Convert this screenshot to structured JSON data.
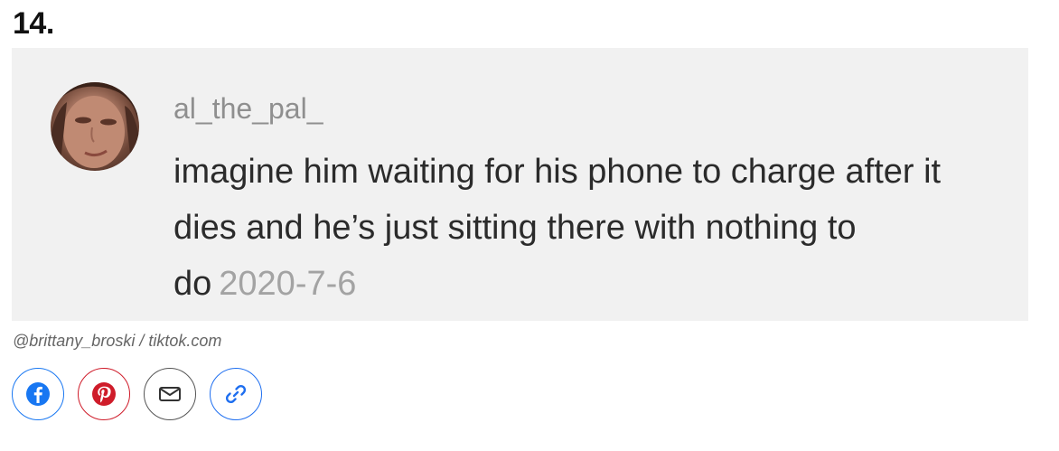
{
  "item": {
    "number": "14."
  },
  "comment": {
    "username": "al_the_pal_",
    "text": "imagine him waiting for his phone to charge after it dies and he’s just sitting there with nothing to do",
    "date": "2020-7-6"
  },
  "credit": "@brittany_broski / tiktok.com",
  "share_buttons": [
    {
      "name": "facebook",
      "icon": "facebook-icon",
      "color": "#1877f2"
    },
    {
      "name": "pinterest",
      "icon": "pinterest-icon",
      "color": "#cf1c2a"
    },
    {
      "name": "email",
      "icon": "email-icon",
      "color": "#555555"
    },
    {
      "name": "copy-link",
      "icon": "link-icon",
      "color": "#1f6ff0"
    }
  ],
  "colors": {
    "card_background": "#f1f1f1",
    "username": "#8f8f8f",
    "comment_text": "#2b2b2b",
    "date": "#a3a3a3"
  }
}
